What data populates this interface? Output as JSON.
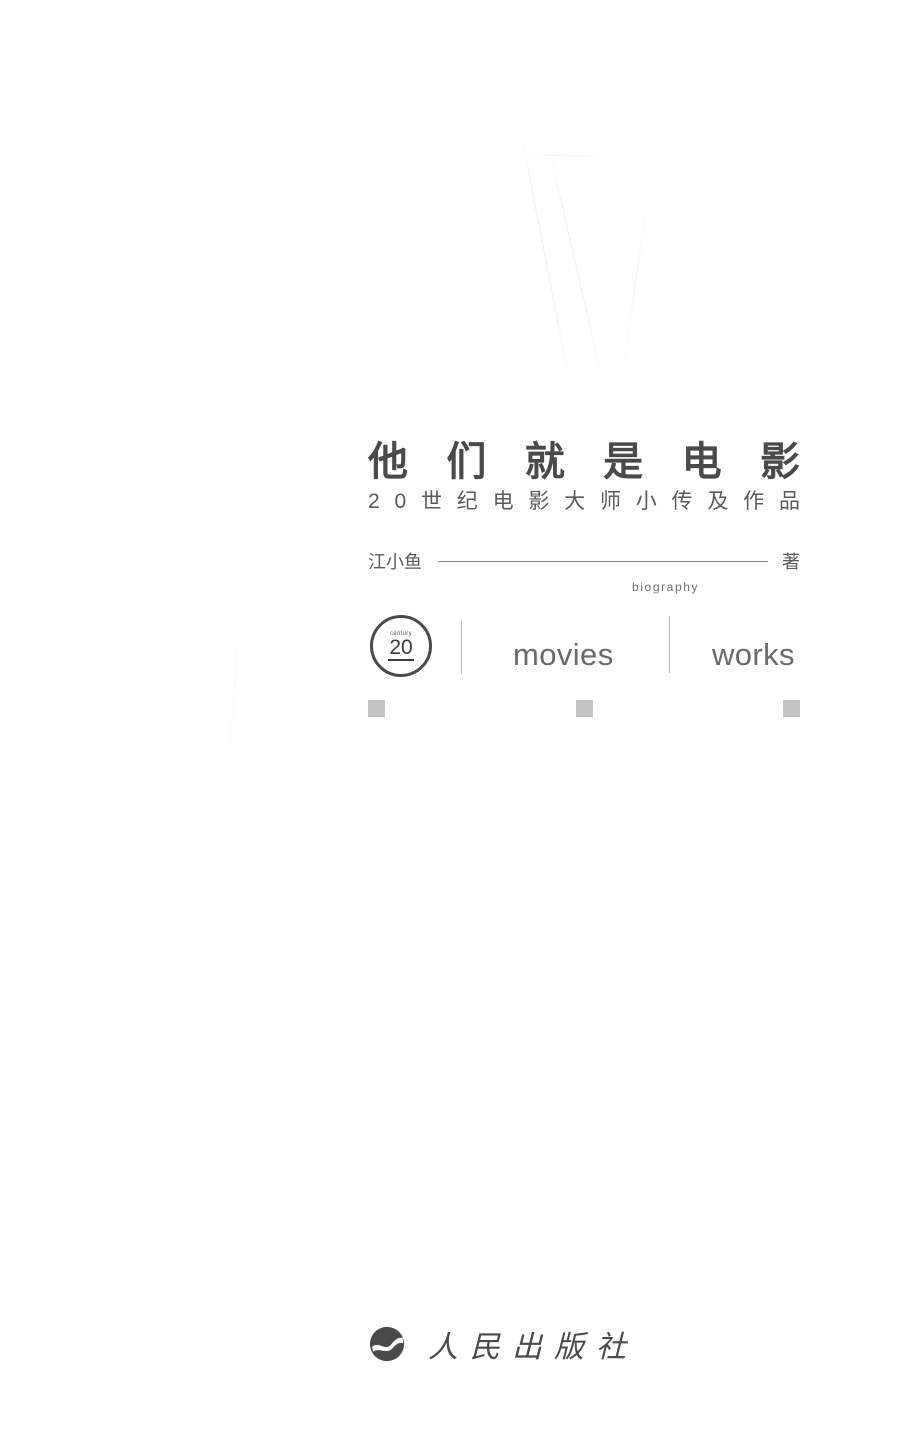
{
  "page": {
    "kind": "book-title-page",
    "background_color": "#ffffff",
    "ink_color": "#4a4a4a"
  },
  "eyebrow": {
    "badge": {
      "small_label": "century",
      "number": "20",
      "icon_name": "century-20-circle-badge"
    },
    "biography_label": "biography",
    "movies_label": "movies",
    "works_label": "works",
    "divider_color": "#b9b9b9"
  },
  "title": {
    "main": [
      "他",
      "们",
      "就",
      "是",
      "电",
      "影"
    ],
    "main_text": "他们就是电影",
    "subtitle": [
      "2",
      "0",
      "世",
      "纪",
      "电",
      "影",
      "大",
      "师",
      "小",
      "传",
      "及",
      "作",
      "品"
    ],
    "subtitle_text": "20世纪电影大师小传及作品"
  },
  "author": {
    "name": "江小鱼",
    "role": "著",
    "rule_color": "#888888"
  },
  "decoration": {
    "squares": [
      "square-left",
      "square-center",
      "square-right"
    ],
    "square_color": "#b0b0b0"
  },
  "publisher": {
    "name": "人民出版社",
    "logo_name": "people-publishing-house-logo",
    "logo_color": "#4a4a4a"
  }
}
